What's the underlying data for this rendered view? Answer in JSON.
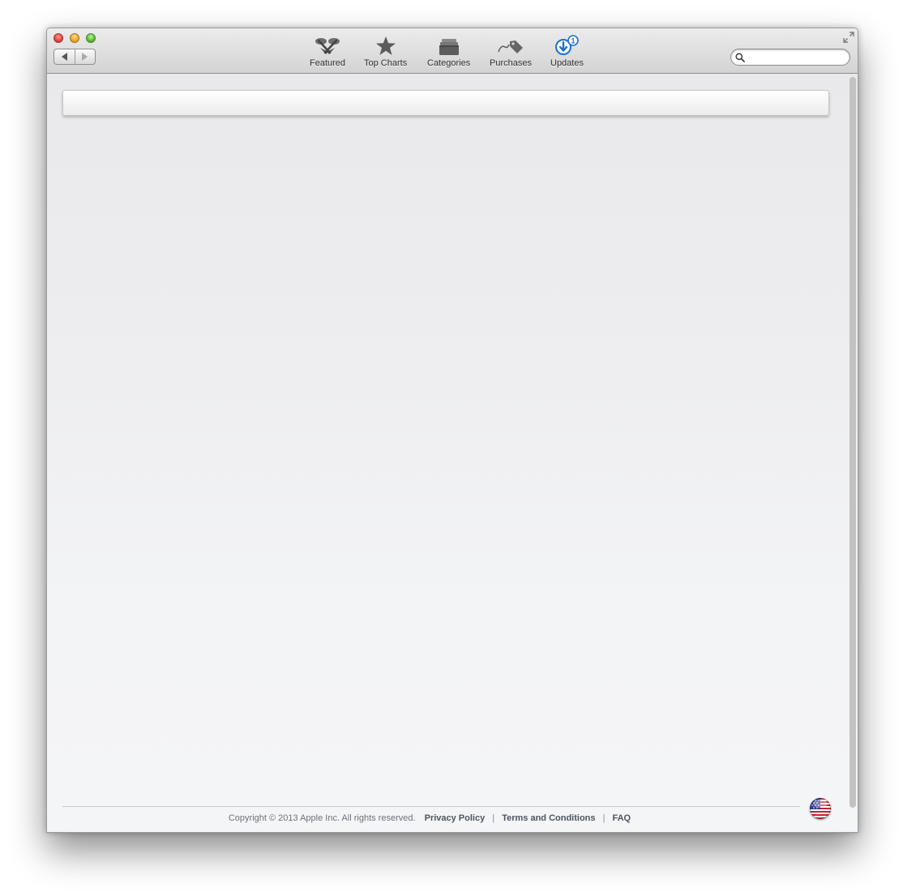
{
  "toolbar": {
    "items": [
      {
        "label": "Featured",
        "icon": "featured-icon"
      },
      {
        "label": "Top Charts",
        "icon": "star-icon"
      },
      {
        "label": "Categories",
        "icon": "categories-icon"
      },
      {
        "label": "Purchases",
        "icon": "price-tag-icon"
      },
      {
        "label": "Updates",
        "icon": "updates-icon",
        "badge": "1"
      }
    ],
    "search": {
      "value": "",
      "placeholder": ""
    }
  },
  "footer": {
    "copyright": "Copyright © 2013 Apple Inc. All rights reserved.",
    "links": [
      "Privacy Policy",
      "Terms and Conditions",
      "FAQ"
    ],
    "separator": "|"
  },
  "colors": {
    "accent": "#1a6fd6",
    "content_bg": "#f3f4f6",
    "titlebar_top": "#ececec",
    "titlebar_bottom": "#d3d3d3"
  }
}
